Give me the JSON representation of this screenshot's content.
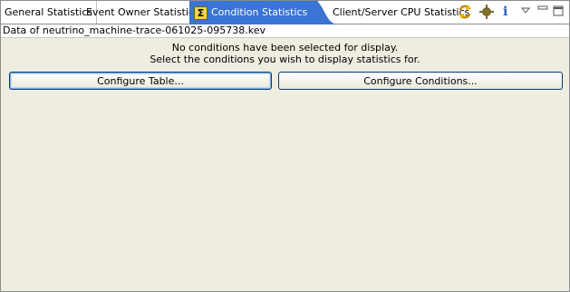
{
  "tabs": [
    {
      "label": "General Statistics"
    },
    {
      "label": "Event Owner Statistics"
    },
    {
      "label": "Condition Statistics"
    },
    {
      "label": "Client/Server CPU Statistics"
    }
  ],
  "active_tab_icon": "sigma-icon",
  "close_glyph": "✕",
  "toolbar": {
    "icons": [
      "refresh-icon",
      "settings-gear-icon",
      "info-icon",
      "view-menu-icon",
      "minimize-icon",
      "maximize-icon"
    ],
    "info_glyph": "i"
  },
  "header": {
    "text": "Data of neutrino_machine-trace-061025-095738.kev"
  },
  "message": {
    "line1": "No conditions have been selected for display.",
    "line2": "Select the conditions you wish to display statistics for."
  },
  "buttons": {
    "configure_table": "Configure Table...",
    "configure_conditions": "Configure Conditions..."
  },
  "colors": {
    "active_tab": "#3a74d4",
    "panel_bg": "#efede0",
    "button_border": "#003c74"
  }
}
